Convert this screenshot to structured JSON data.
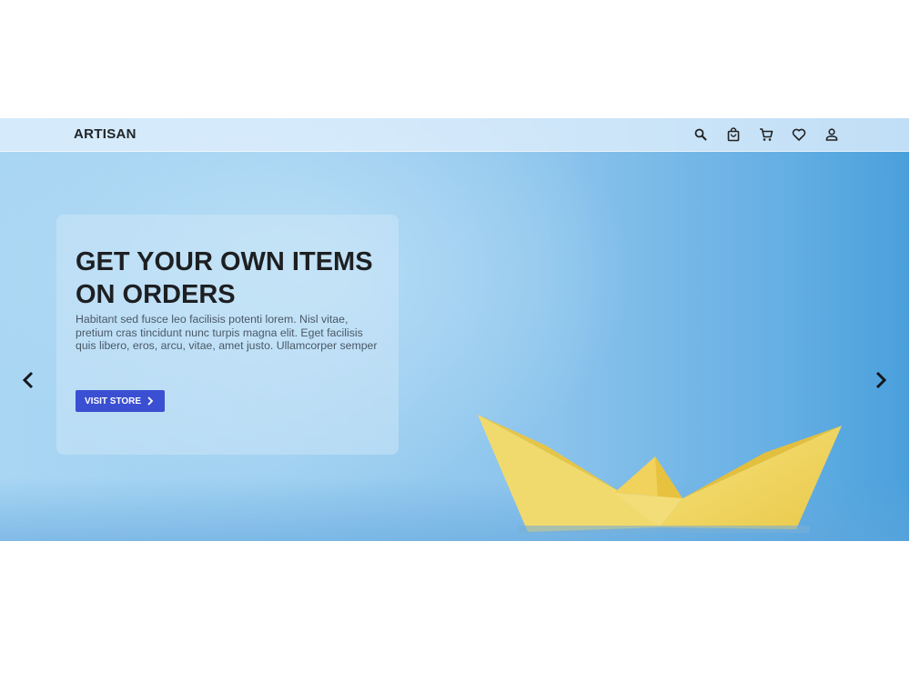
{
  "header": {
    "brand": "ARTISAN",
    "icons": [
      "search-icon",
      "shopping-bag-icon",
      "cart-icon",
      "heart-icon",
      "user-icon"
    ]
  },
  "hero": {
    "title_line1": "GET YOUR OWN ITEMS",
    "title_line2": "ON ORDERS",
    "description": "Habitant sed fusce leo facilisis potenti lorem. Nisl vitae, pretium cras tincidunt nunc turpis magna elit. Eget facilisis quis libero, eros, arcu, vitae, amet justo. Ullamcorper semper",
    "cta_label": "VISIT STORE",
    "prev_icon": "chevron-left-icon",
    "next_icon": "chevron-right-icon",
    "image": "paper-boat"
  },
  "colors": {
    "cta": "#3a4fd1",
    "text_dark": "#1d1f22",
    "boat": "#f2d65c",
    "sky": "#8cc4ec"
  }
}
